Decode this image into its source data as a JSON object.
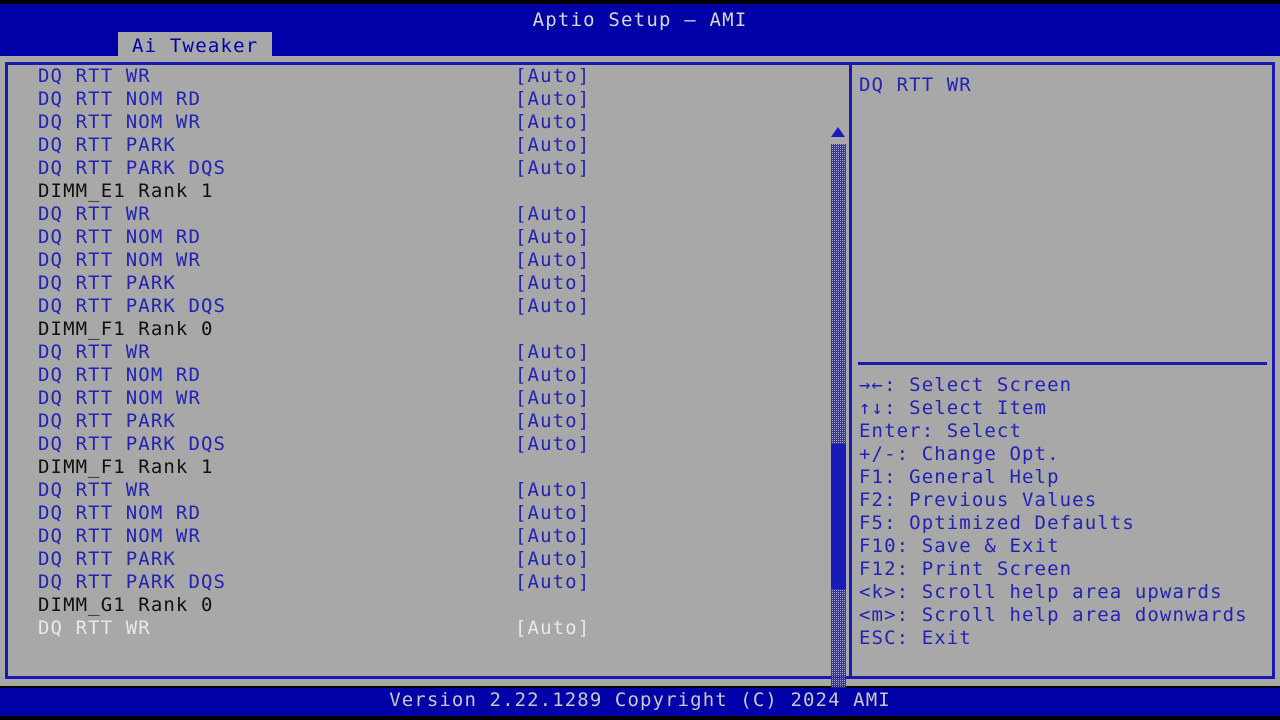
{
  "window": {
    "title": "Aptio Setup – AMI",
    "active_tab": "Ai Tweaker",
    "accent_blue": "#0000a8",
    "panel_gray": "#a8a8a8",
    "item_blue": "#2222b4",
    "selected_white": "#e8e8e8"
  },
  "footer": {
    "version_text": "Version 2.22.1289 Copyright (C) 2024 AMI"
  },
  "main": {
    "rows": [
      {
        "type": "item",
        "label": "DQ RTT WR",
        "value": "[Auto]",
        "selected": false
      },
      {
        "type": "item",
        "label": "DQ RTT NOM RD",
        "value": "[Auto]",
        "selected": false
      },
      {
        "type": "item",
        "label": "DQ RTT NOM WR",
        "value": "[Auto]",
        "selected": false
      },
      {
        "type": "item",
        "label": "DQ RTT PARK",
        "value": "[Auto]",
        "selected": false
      },
      {
        "type": "item",
        "label": "DQ RTT PARK DQS",
        "value": "[Auto]",
        "selected": false
      },
      {
        "type": "header",
        "label": "DIMM_E1 Rank 1",
        "value": "",
        "selected": false
      },
      {
        "type": "item",
        "label": "DQ RTT WR",
        "value": "[Auto]",
        "selected": false
      },
      {
        "type": "item",
        "label": "DQ RTT NOM RD",
        "value": "[Auto]",
        "selected": false
      },
      {
        "type": "item",
        "label": "DQ RTT NOM WR",
        "value": "[Auto]",
        "selected": false
      },
      {
        "type": "item",
        "label": "DQ RTT PARK",
        "value": "[Auto]",
        "selected": false
      },
      {
        "type": "item",
        "label": "DQ RTT PARK DQS",
        "value": "[Auto]",
        "selected": false
      },
      {
        "type": "header",
        "label": "DIMM_F1 Rank 0",
        "value": "",
        "selected": false
      },
      {
        "type": "item",
        "label": "DQ RTT WR",
        "value": "[Auto]",
        "selected": false
      },
      {
        "type": "item",
        "label": "DQ RTT NOM RD",
        "value": "[Auto]",
        "selected": false
      },
      {
        "type": "item",
        "label": "DQ RTT NOM WR",
        "value": "[Auto]",
        "selected": false
      },
      {
        "type": "item",
        "label": "DQ RTT PARK",
        "value": "[Auto]",
        "selected": false
      },
      {
        "type": "item",
        "label": "DQ RTT PARK DQS",
        "value": "[Auto]",
        "selected": false
      },
      {
        "type": "header",
        "label": "DIMM_F1 Rank 1",
        "value": "",
        "selected": false
      },
      {
        "type": "item",
        "label": "DQ RTT WR",
        "value": "[Auto]",
        "selected": false
      },
      {
        "type": "item",
        "label": "DQ RTT NOM RD",
        "value": "[Auto]",
        "selected": false
      },
      {
        "type": "item",
        "label": "DQ RTT NOM WR",
        "value": "[Auto]",
        "selected": false
      },
      {
        "type": "item",
        "label": "DQ RTT PARK",
        "value": "[Auto]",
        "selected": false
      },
      {
        "type": "item",
        "label": "DQ RTT PARK DQS",
        "value": "[Auto]",
        "selected": false
      },
      {
        "type": "header",
        "label": "DIMM_G1 Rank 0",
        "value": "",
        "selected": false
      },
      {
        "type": "item",
        "label": "DQ RTT WR",
        "value": "[Auto]",
        "selected": true
      }
    ]
  },
  "scrollbar": {
    "up_arrow_icon": "triangle-up-icon",
    "down_arrow_icon": "triangle-down-icon",
    "thumb_top_pct": 54,
    "thumb_height_pct": 26
  },
  "help": {
    "title": "DQ RTT WR",
    "body": "",
    "legend": [
      "→←: Select Screen",
      "↑↓: Select Item",
      "Enter: Select",
      "+/-: Change Opt.",
      "F1: General Help",
      "F2: Previous Values",
      "F5: Optimized Defaults",
      "F10: Save & Exit",
      "F12: Print Screen",
      "<k>: Scroll help area upwards",
      "<m>: Scroll help area downwards",
      "ESC: Exit"
    ]
  }
}
